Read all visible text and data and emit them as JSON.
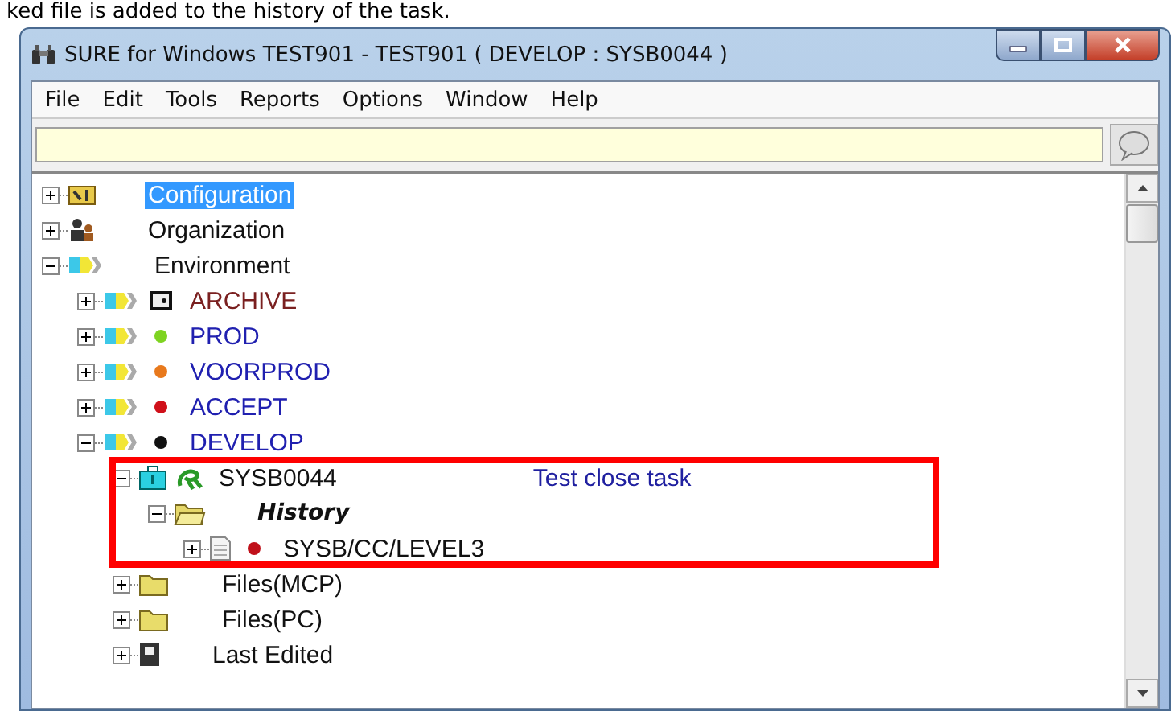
{
  "caption": "ked file is added to the history of the task.",
  "window": {
    "title": "SURE for Windows TEST901 - TEST901 ( DEVELOP : SYSB0044 )"
  },
  "menu": [
    "File",
    "Edit",
    "Tools",
    "Reports",
    "Options",
    "Window",
    "Help"
  ],
  "tree": [
    {
      "label": "Configuration",
      "kind": "config",
      "expanded": false,
      "selected": true
    },
    {
      "label": "Organization",
      "kind": "org",
      "expanded": false,
      "selected": false
    },
    {
      "label": "Environment",
      "kind": "env-group",
      "expanded": true,
      "selected": false,
      "children": [
        {
          "label": "ARCHIVE",
          "kind": "archive",
          "expanded": false,
          "selected": false
        },
        {
          "label": "PROD",
          "kind": "env",
          "color": "#7ed321",
          "expanded": false,
          "selected": false
        },
        {
          "label": "VOORPROD",
          "kind": "env",
          "color": "#e8791c",
          "expanded": false,
          "selected": false
        },
        {
          "label": "ACCEPT",
          "kind": "env",
          "color": "#d0101a",
          "expanded": false,
          "selected": false
        },
        {
          "label": "DEVELOP",
          "kind": "env",
          "color": "#111111",
          "expanded": true,
          "selected": false,
          "children": [
            {
              "label": "SYSB0044",
              "kind": "task",
              "description": "Test close task",
              "expanded": true,
              "selected": false,
              "children": [
                {
                  "label": "History",
                  "kind": "history",
                  "expanded": true,
                  "selected": false,
                  "children": [
                    {
                      "label": "SYSB/CC/LEVEL3",
                      "kind": "file",
                      "color": "#c0101a",
                      "expanded": false,
                      "selected": false
                    }
                  ]
                }
              ]
            },
            {
              "label": "Files(MCP)",
              "kind": "folder",
              "expanded": false,
              "selected": false
            },
            {
              "label": "Files(PC)",
              "kind": "folder",
              "expanded": false,
              "selected": false
            },
            {
              "label": "Last Edited",
              "kind": "last",
              "expanded": false,
              "selected": false
            }
          ]
        }
      ]
    }
  ]
}
